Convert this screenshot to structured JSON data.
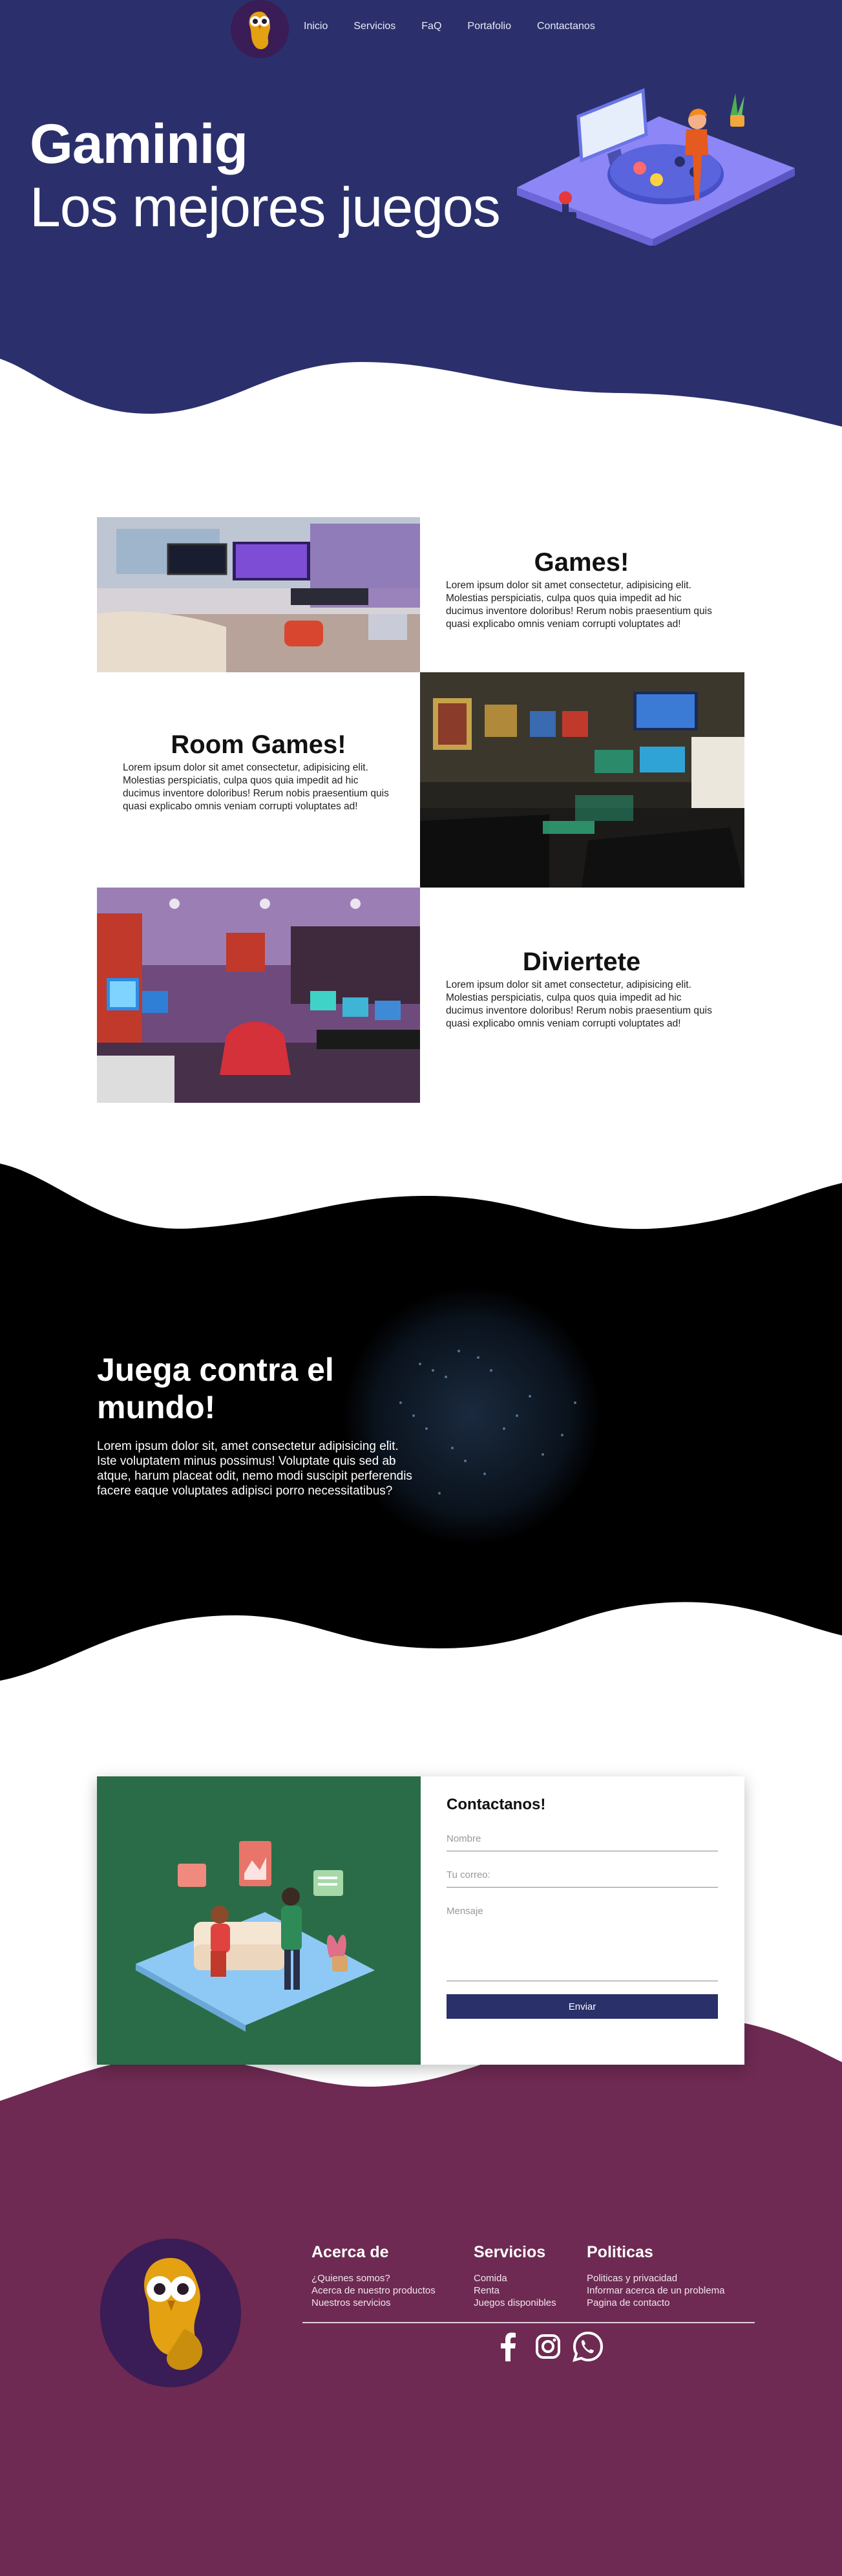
{
  "nav": {
    "links": [
      "Inicio",
      "Servicios",
      "FaQ",
      "Portafolio",
      "Contactanos"
    ]
  },
  "hero": {
    "title": "Gaminig",
    "subtitle": "Los mejores juegos"
  },
  "features": [
    {
      "title": "Games!",
      "text": "Lorem ipsum dolor sit amet consectetur, adipisicing elit. Molestias perspiciatis, culpa quos quia impedit ad hic ducimus inventore doloribus! Rerum nobis praesentium quis quasi explicabo omnis veniam corrupti voluptates ad!"
    },
    {
      "title": "Room Games!",
      "text": "Lorem ipsum dolor sit amet consectetur, adipisicing elit. Molestias perspiciatis, culpa quos quia impedit ad hic ducimus inventore doloribus! Rerum nobis praesentium quis quasi explicabo omnis veniam corrupti voluptates ad!"
    },
    {
      "title": "Diviertete",
      "text": "Lorem ipsum dolor sit amet consectetur, adipisicing elit. Molestias perspiciatis, culpa quos quia impedit ad hic ducimus inventore doloribus! Rerum nobis praesentium quis quasi explicabo omnis veniam corrupti voluptates ad!"
    }
  ],
  "world": {
    "title": "Juega contra el mundo!",
    "text": "Lorem ipsum dolor sit, amet consectetur adipisicing elit. Iste voluptatem minus possimus! Voluptate quis sed ab atque, harum placeat odit, nemo modi suscipit perferendis facere eaque voluptates adipisci porro necessitatibus?"
  },
  "contact": {
    "title": "Contactanos!",
    "name_placeholder": "Nombre",
    "email_placeholder": "Tu correo:",
    "message_placeholder": "Mensaje",
    "send_label": "Enviar"
  },
  "footer": {
    "about": {
      "heading": "Acerca de",
      "links": [
        "¿Quienes somos?",
        "Acerca de nuestro productos",
        "Nuestros servicios"
      ]
    },
    "services": {
      "heading": "Servicios",
      "links": [
        "Comida",
        "Renta",
        "Juegos disponibles"
      ]
    },
    "policies": {
      "heading": "Politicas",
      "links": [
        "Politicas y privacidad",
        "Informar acerca de un problema",
        "Pagina de contacto"
      ]
    },
    "socials": [
      "facebook-icon",
      "instagram-icon",
      "whatsapp-icon"
    ]
  },
  "colors": {
    "hero": "#2b306c",
    "footer": "#6e2a52",
    "contact_panel": "#2b6c48",
    "button": "#29306a",
    "owl_bg": "#3a1c56",
    "owl_gold": "#e4a112"
  }
}
